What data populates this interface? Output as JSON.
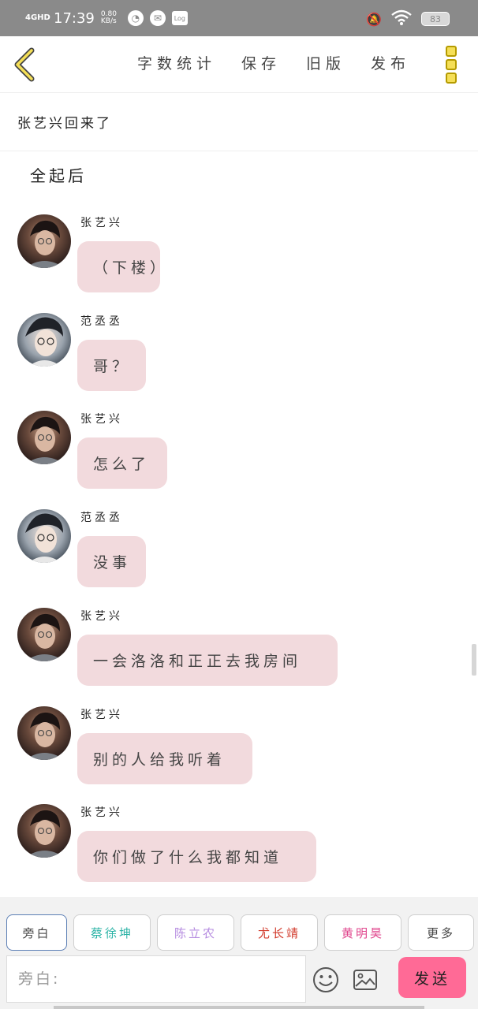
{
  "status_bar": {
    "network": "4GHD",
    "time": "17:39",
    "speed_value": "0.80",
    "speed_unit": "KB/s",
    "log_label": "Log",
    "battery": "83"
  },
  "toolbar": {
    "actions": [
      "字数统计",
      "保存",
      "旧版",
      "发布"
    ]
  },
  "story_title": "张艺兴回来了",
  "narration": "全起后",
  "messages": [
    {
      "speaker": "张艺兴",
      "text": "（下楼）",
      "avatar": "avatar-zhang",
      "bubble_width": 105
    },
    {
      "speaker": "范丞丞",
      "text": "哥？",
      "avatar": "avatar-fan",
      "bubble_width": 87
    },
    {
      "speaker": "张艺兴",
      "text": "怎么了",
      "avatar": "avatar-zhang",
      "bubble_width": 114
    },
    {
      "speaker": "范丞丞",
      "text": "没事",
      "avatar": "avatar-fan",
      "bubble_width": 87
    },
    {
      "speaker": "张艺兴",
      "text": "一会洛洛和正正去我房间",
      "avatar": "avatar-zhang",
      "bubble_width": 330
    },
    {
      "speaker": "张艺兴",
      "text": "别的人给我听着",
      "avatar": "avatar-zhang",
      "bubble_width": 222
    },
    {
      "speaker": "张艺兴",
      "text": "你们做了什么我都知道",
      "avatar": "avatar-zhang",
      "bubble_width": 303
    }
  ],
  "role_chips": [
    {
      "label": "旁白",
      "color": "#444444"
    },
    {
      "label": "蔡徐坤",
      "color": "#2bb3a6"
    },
    {
      "label": "陈立农",
      "color": "#b58be0"
    },
    {
      "label": "尤长靖",
      "color": "#d23b2c"
    },
    {
      "label": "黄明昊",
      "color": "#e0468d"
    },
    {
      "label": "更多",
      "color": "#444444"
    }
  ],
  "input": {
    "placeholder": "旁白:"
  },
  "send_label": "发送",
  "colors": {
    "bubble": "#f2dadd",
    "send": "#ff6a96",
    "menu": "#f5df57"
  }
}
